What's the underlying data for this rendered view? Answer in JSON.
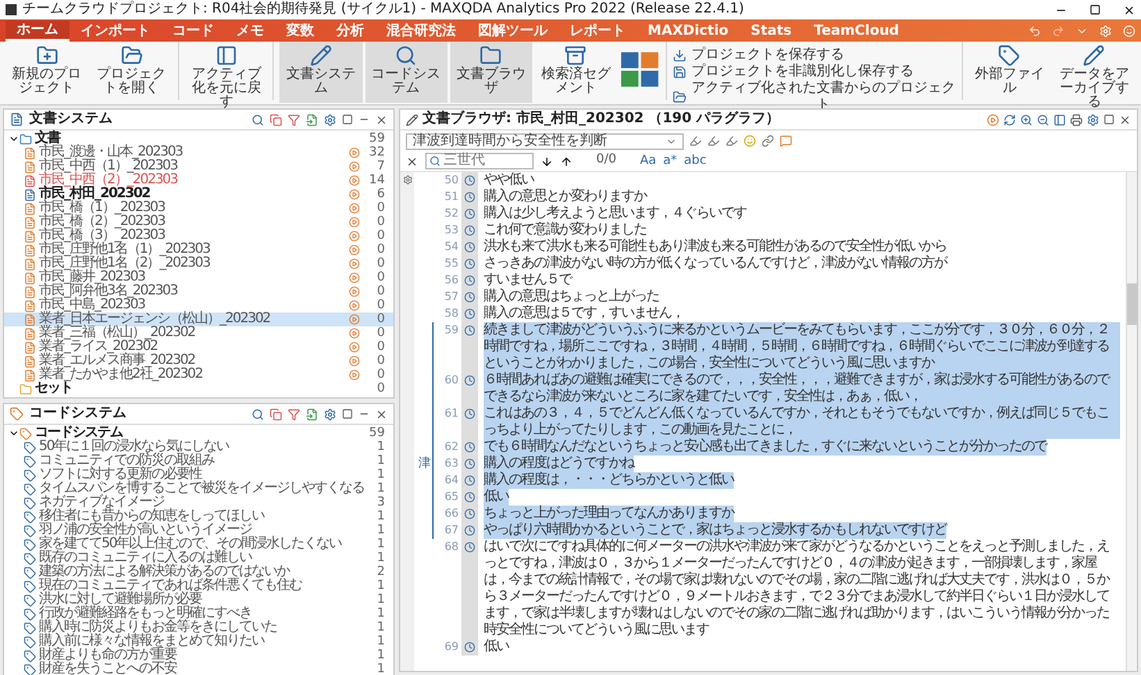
{
  "window": {
    "title": "チームクラウドプロジェクト: R04社会的期待発見 (サイクル1) - MAXQDA Analytics Pro 2022 (Release 22.4.1)"
  },
  "menu_tabs": [
    {
      "label": "ホーム",
      "selected": true
    },
    {
      "label": "インポート",
      "selected": false
    },
    {
      "label": "コード",
      "selected": false
    },
    {
      "label": "メモ",
      "selected": false
    },
    {
      "label": "変数",
      "selected": false
    },
    {
      "label": "分析",
      "selected": false
    },
    {
      "label": "混合研究法",
      "selected": false
    },
    {
      "label": "図解ツール",
      "selected": false
    },
    {
      "label": "レポート",
      "selected": false
    },
    {
      "label": "MAXDictio",
      "selected": false
    },
    {
      "label": "Stats",
      "selected": false
    },
    {
      "label": "TeamCloud",
      "selected": false
    }
  ],
  "ribbon": [
    {
      "kind": "large",
      "label": "新規のプロジェクト",
      "selected": false
    },
    {
      "kind": "large",
      "label": "プロジェクトを開く",
      "selected": false
    },
    {
      "kind": "separator"
    },
    {
      "kind": "large",
      "label": "アクティブ化を元に戻す",
      "selected": false
    },
    {
      "kind": "separator"
    },
    {
      "kind": "large",
      "label": "文書システム",
      "selected": true
    },
    {
      "kind": "large",
      "label": "コードシステム",
      "selected": true
    },
    {
      "kind": "large",
      "label": "文書ブラウザ",
      "selected": true
    },
    {
      "kind": "large",
      "label": "検索済セグメント",
      "selected": false
    },
    {
      "kind": "grid"
    },
    {
      "kind": "separator"
    },
    {
      "kind": "stack",
      "items": [
        "プロジェクトを保存する",
        "プロジェクトを非識別化し保存する",
        "アクティブ化された文書からのプロジェクト"
      ]
    },
    {
      "kind": "separator"
    },
    {
      "kind": "large",
      "label": "外部ファイル",
      "selected": false
    },
    {
      "kind": "large",
      "label": "データをアーカイブする",
      "selected": false
    }
  ],
  "document_system": {
    "title": "文書システム",
    "root": {
      "label": "文書",
      "count": "59",
      "expanded": true,
      "children": [
        {
          "label": "市民_渡邊・山本_202303",
          "count": "32",
          "kind": "normal",
          "selected": false
        },
        {
          "label": "市民_中西（1）_202303",
          "count": "7",
          "kind": "normal",
          "selected": false
        },
        {
          "label": "市民_中西（2）_202303",
          "count": "14",
          "kind": "flagged",
          "selected": false
        },
        {
          "label": "市民_村田_202302",
          "count": "6",
          "kind": "open",
          "selected": false
        },
        {
          "label": "市民_橋（1）_202303",
          "count": "0",
          "kind": "normal",
          "selected": false
        },
        {
          "label": "市民_橋（2）_202303",
          "count": "0",
          "kind": "normal",
          "selected": false
        },
        {
          "label": "市民_橋（3）_202303",
          "count": "0",
          "kind": "normal",
          "selected": false
        },
        {
          "label": "市民_庄野他1名（1）_202303",
          "count": "0",
          "kind": "normal",
          "selected": false
        },
        {
          "label": "市民_庄野他1名（2）_202303",
          "count": "0",
          "kind": "normal",
          "selected": false
        },
        {
          "label": "市民_藤井_202303",
          "count": "0",
          "kind": "normal",
          "selected": false
        },
        {
          "label": "市民_阿弁他3名_202303",
          "count": "0",
          "kind": "normal",
          "selected": false
        },
        {
          "label": "市民_中島_202303",
          "count": "0",
          "kind": "normal",
          "selected": false
        },
        {
          "label": "業者_日本エージェンシ（松山）_202302",
          "count": "0",
          "kind": "normal",
          "selected": true
        },
        {
          "label": "業者_三福（松山）_202302",
          "count": "0",
          "kind": "normal",
          "selected": false
        },
        {
          "label": "業者_ライス_202302",
          "count": "0",
          "kind": "normal",
          "selected": false
        },
        {
          "label": "業者_エルメス商事_202302",
          "count": "0",
          "kind": "normal",
          "selected": false
        },
        {
          "label": "業者_たかやま他2社_202302",
          "count": "0",
          "kind": "normal",
          "selected": false
        }
      ]
    },
    "sets": {
      "label": "セット",
      "count": "0"
    }
  },
  "code_system": {
    "title": "コードシステム",
    "root": {
      "label": "コードシステム",
      "count": "59",
      "expanded": true,
      "children": [
        {
          "label": "50年に１回の浸水なら気にしない",
          "count": "1"
        },
        {
          "label": "コミュニティでの防災の取組み",
          "count": "1"
        },
        {
          "label": "ソフトに対する更新の必要性",
          "count": "1"
        },
        {
          "label": "タイムスパンを博することで被災をイメージしやすくなる",
          "count": "1"
        },
        {
          "label": "ネガティブなイメージ",
          "count": "3"
        },
        {
          "label": "移住者にも昔からの知恵をしってほしい",
          "count": "1"
        },
        {
          "label": "羽ノ浦の安全性が高いというイメージ",
          "count": "1"
        },
        {
          "label": "家を建てて50年以上住むので、その間浸水したくない",
          "count": "1"
        },
        {
          "label": "既存のコミュニティに入るのは難しい",
          "count": "1"
        },
        {
          "label": "建築の方法による解決策があるのではないか",
          "count": "2"
        },
        {
          "label": "現在のコミュニティであれば条件悪くても住む",
          "count": "1"
        },
        {
          "label": "洪水に対して避難場所が必要",
          "count": "1"
        },
        {
          "label": "行政が避難経路をもっと明確にすべき",
          "count": "1"
        },
        {
          "label": "購入時に防災よりもお金等をきにしていた",
          "count": "1"
        },
        {
          "label": "購入前に様々な情報をまとめて知りたい",
          "count": "1"
        },
        {
          "label": "財産よりも命の方が重要",
          "count": "1"
        },
        {
          "label": "財産を失うことへの不安",
          "count": "1"
        }
      ]
    }
  },
  "document_browser": {
    "title": "文書ブラウザ: 市民_村田_202302 （190 パラグラフ）",
    "code_select": "津波到達時間から安全性を判断",
    "search": {
      "value": "三世代"
    },
    "match_count": "0/0",
    "search_options": [
      "Aa",
      "a*",
      "abc"
    ],
    "coding_label": "津",
    "paragraphs": [
      {
        "number": "50",
        "text": "やや低い",
        "selected": false
      },
      {
        "number": "51",
        "text": "購入の意思とか変わりますか",
        "selected": false
      },
      {
        "number": "52",
        "text": "購入は少し考えようと思います，４ぐらいです",
        "selected": false
      },
      {
        "number": "53",
        "text": "これ何で意識が変わりました",
        "selected": false
      },
      {
        "number": "54",
        "text": "洪水も来て洪水も来る可能性もあり津波も来る可能性があるので安全性が低いから",
        "selected": false
      },
      {
        "number": "55",
        "text": "さっきあの津波がない時の方が低くなっているんですけど，津波がない情報の方が",
        "selected": false
      },
      {
        "number": "56",
        "text": "すいません５で",
        "selected": false
      },
      {
        "number": "57",
        "text": "購入の意思はちょっと上がった",
        "selected": false
      },
      {
        "number": "58",
        "text": "購入の意思は５です，すいません，",
        "selected": false
      },
      {
        "number": "59",
        "text": "続きまして津波がどういうふうに来るかというムービーをみてもらいます，ここが分です，３０分，６０分，２時間ですね，場所ここですね，３時間，４時間，５時間，６時間ですね，６時間ぐらいでここに津波が到達するということがわかりました，この場合，安全性についてどういう風に思いますか",
        "selected": true
      },
      {
        "number": "60",
        "text": "６時間あればあの避難は確実にできるので，，，安全性，，，避難できますが，家は浸水する可能性があるのでできるなら津波が来ないところに家を建てたいです，安全性は，あぁ，低い，",
        "selected": true
      },
      {
        "number": "61",
        "text": "これはあの３，４，５でどんどん低くなっているんですか，それともそうでもないですか，例えば同じ５でもこっちより上がってたりします，この動画を見たことに，",
        "selected": true
      },
      {
        "number": "62",
        "text": "でも６時間なんだなというちょっと安心感も出てきました，すぐに来ないということが分かったので",
        "selected": true
      },
      {
        "number": "63",
        "text": "購入の程度はどうですかね",
        "selected": true
      },
      {
        "number": "64",
        "text": "購入の程度は，・・・どちらかというと低い",
        "selected": true
      },
      {
        "number": "65",
        "text": "低い",
        "selected": true
      },
      {
        "number": "66",
        "text": "ちょっと上がった理由ってなんかありますか",
        "selected": true
      },
      {
        "number": "67",
        "text": "やっぱり六時間かかるということで，家はちょっと浸水するかもしれないですけど",
        "selected": true
      },
      {
        "number": "68",
        "text": "はいで次にですね具体的に何メーターの洪水や津波が来て家がどうなるかということをえっと予測しました，えっとですね，津波は０，３から１メーターだったんですけど０，４の津波が起きます，一部損壊します，家屋は，今までの統計情報で，その場で家は壊れないのでその場，家の二階に逃げれば大丈夫です，洪水は０，５から３メーターだったんですけど０，９メートルおきます，で２３分でまあ浸水して約半日ぐらい１日か浸水してます，で家は半壊しますが壊れはしないのでその家の二階に逃げれば助かります，はいこういう情報が分かった時安全性についてどういう風に思います",
        "selected": false
      },
      {
        "number": "69",
        "text": "低い",
        "selected": false
      }
    ]
  }
}
